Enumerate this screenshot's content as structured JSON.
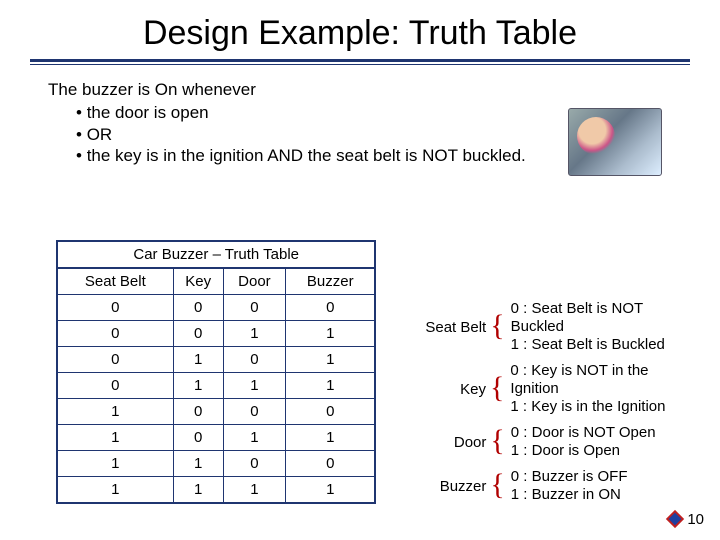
{
  "title": "Design Example: Truth Table",
  "intro": {
    "lead": "The buzzer is On whenever",
    "bullets": [
      "the door is open",
      "OR",
      "the key is in the ignition AND the seat belt is NOT buckled."
    ]
  },
  "table": {
    "caption": "Car Buzzer – Truth Table",
    "headers": [
      "Seat Belt",
      "Key",
      "Door",
      "Buzzer"
    ],
    "rows": [
      [
        "0",
        "0",
        "0",
        "0"
      ],
      [
        "0",
        "0",
        "1",
        "1"
      ],
      [
        "0",
        "1",
        "0",
        "1"
      ],
      [
        "0",
        "1",
        "1",
        "1"
      ],
      [
        "1",
        "0",
        "0",
        "0"
      ],
      [
        "1",
        "0",
        "1",
        "1"
      ],
      [
        "1",
        "1",
        "0",
        "0"
      ],
      [
        "1",
        "1",
        "1",
        "1"
      ]
    ]
  },
  "legend": [
    {
      "name": "Seat Belt",
      "zero": "0 : Seat Belt is NOT Buckled",
      "one": "1 : Seat Belt is Buckled"
    },
    {
      "name": "Key",
      "zero": "0 : Key is NOT in the Ignition",
      "one": "1 : Key is in the Ignition"
    },
    {
      "name": "Door",
      "zero": "0 : Door is NOT Open",
      "one": "1 : Door is Open"
    },
    {
      "name": "Buzzer",
      "zero": "0 : Buzzer is OFF",
      "one": "1 : Buzzer in ON"
    }
  ],
  "page_number": "10",
  "chart_data": {
    "type": "table",
    "title": "Car Buzzer – Truth Table",
    "columns": [
      "Seat Belt",
      "Key",
      "Door",
      "Buzzer"
    ],
    "rows": [
      [
        0,
        0,
        0,
        0
      ],
      [
        0,
        0,
        1,
        1
      ],
      [
        0,
        1,
        0,
        1
      ],
      [
        0,
        1,
        1,
        1
      ],
      [
        1,
        0,
        0,
        0
      ],
      [
        1,
        0,
        1,
        1
      ],
      [
        1,
        1,
        0,
        0
      ],
      [
        1,
        1,
        1,
        1
      ]
    ]
  }
}
